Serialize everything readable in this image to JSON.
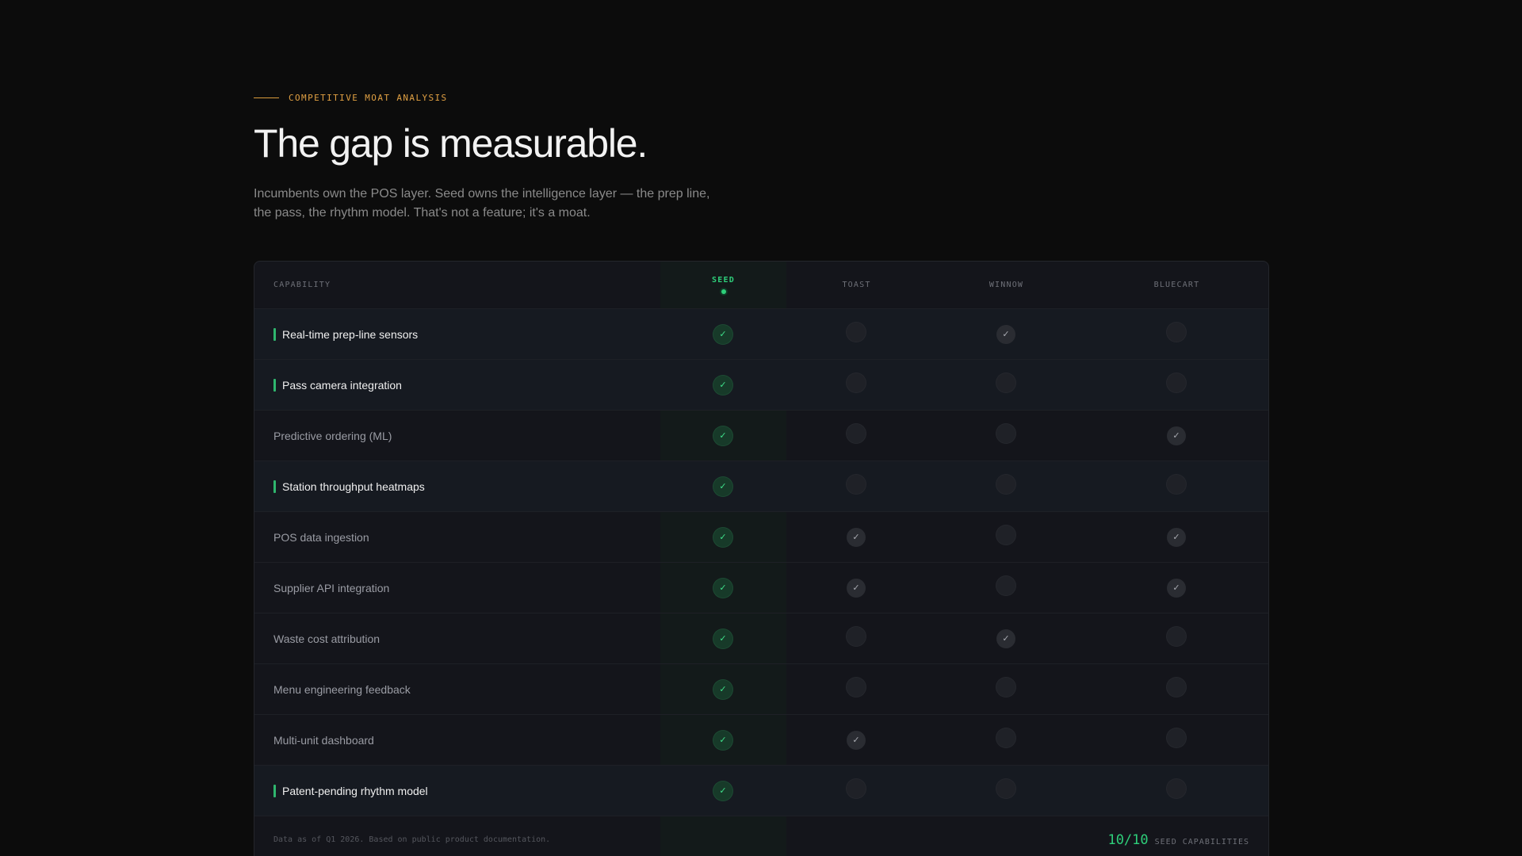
{
  "header": {
    "eyebrow": "COMPETITIVE MOAT ANALYSIS",
    "title": "The gap is measurable.",
    "subtitle": "Incumbents own the POS layer. Seed owns the intelligence layer — the prep line, the pass, the rhythm model. That's not a feature; it's a moat."
  },
  "table": {
    "columns": [
      "CAPABILITY",
      "SEED",
      "TOAST",
      "WINNOW",
      "BLUECART"
    ],
    "check_glyph": "✓",
    "rows": [
      {
        "label": "Real-time prep-line sensors",
        "highlight": true,
        "seed": true,
        "toast": false,
        "winnow": true,
        "bluecart": false
      },
      {
        "label": "Pass camera integration",
        "highlight": true,
        "seed": true,
        "toast": false,
        "winnow": false,
        "bluecart": false
      },
      {
        "label": "Predictive ordering (ML)",
        "highlight": false,
        "seed": true,
        "toast": false,
        "winnow": false,
        "bluecart": true
      },
      {
        "label": "Station throughput heatmaps",
        "highlight": true,
        "seed": true,
        "toast": false,
        "winnow": false,
        "bluecart": false
      },
      {
        "label": "POS data ingestion",
        "highlight": false,
        "seed": true,
        "toast": true,
        "winnow": false,
        "bluecart": true
      },
      {
        "label": "Supplier API integration",
        "highlight": false,
        "seed": true,
        "toast": true,
        "winnow": false,
        "bluecart": true
      },
      {
        "label": "Waste cost attribution",
        "highlight": false,
        "seed": true,
        "toast": false,
        "winnow": true,
        "bluecart": false
      },
      {
        "label": "Menu engineering feedback",
        "highlight": false,
        "seed": true,
        "toast": false,
        "winnow": false,
        "bluecart": false
      },
      {
        "label": "Multi-unit dashboard",
        "highlight": false,
        "seed": true,
        "toast": true,
        "winnow": false,
        "bluecart": false
      },
      {
        "label": "Patent-pending rhythm model",
        "highlight": true,
        "seed": true,
        "toast": false,
        "winnow": false,
        "bluecart": false
      }
    ],
    "footer_note": "Data as of Q1 2026. Based on public product documentation.",
    "score_value": "10/10",
    "score_label": "SEED CAPABILITIES"
  },
  "colors": {
    "accent_green": "#2ecf7a",
    "accent_amber": "#e0a043",
    "background": "#0c0c0c"
  }
}
